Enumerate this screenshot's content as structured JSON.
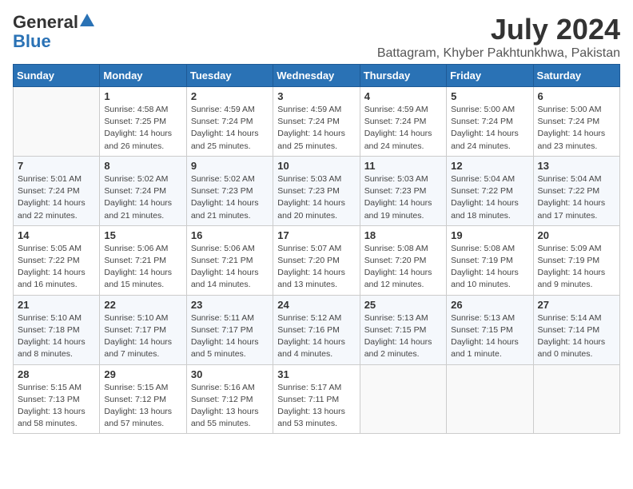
{
  "logo": {
    "general": "General",
    "blue": "Blue"
  },
  "title": "July 2024",
  "subtitle": "Battagram, Khyber Pakhtunkhwa, Pakistan",
  "days_of_week": [
    "Sunday",
    "Monday",
    "Tuesday",
    "Wednesday",
    "Thursday",
    "Friday",
    "Saturday"
  ],
  "weeks": [
    [
      {
        "day": "",
        "info": ""
      },
      {
        "day": "1",
        "info": "Sunrise: 4:58 AM\nSunset: 7:25 PM\nDaylight: 14 hours\nand 26 minutes."
      },
      {
        "day": "2",
        "info": "Sunrise: 4:59 AM\nSunset: 7:24 PM\nDaylight: 14 hours\nand 25 minutes."
      },
      {
        "day": "3",
        "info": "Sunrise: 4:59 AM\nSunset: 7:24 PM\nDaylight: 14 hours\nand 25 minutes."
      },
      {
        "day": "4",
        "info": "Sunrise: 4:59 AM\nSunset: 7:24 PM\nDaylight: 14 hours\nand 24 minutes."
      },
      {
        "day": "5",
        "info": "Sunrise: 5:00 AM\nSunset: 7:24 PM\nDaylight: 14 hours\nand 24 minutes."
      },
      {
        "day": "6",
        "info": "Sunrise: 5:00 AM\nSunset: 7:24 PM\nDaylight: 14 hours\nand 23 minutes."
      }
    ],
    [
      {
        "day": "7",
        "info": "Sunrise: 5:01 AM\nSunset: 7:24 PM\nDaylight: 14 hours\nand 22 minutes."
      },
      {
        "day": "8",
        "info": "Sunrise: 5:02 AM\nSunset: 7:24 PM\nDaylight: 14 hours\nand 21 minutes."
      },
      {
        "day": "9",
        "info": "Sunrise: 5:02 AM\nSunset: 7:23 PM\nDaylight: 14 hours\nand 21 minutes."
      },
      {
        "day": "10",
        "info": "Sunrise: 5:03 AM\nSunset: 7:23 PM\nDaylight: 14 hours\nand 20 minutes."
      },
      {
        "day": "11",
        "info": "Sunrise: 5:03 AM\nSunset: 7:23 PM\nDaylight: 14 hours\nand 19 minutes."
      },
      {
        "day": "12",
        "info": "Sunrise: 5:04 AM\nSunset: 7:22 PM\nDaylight: 14 hours\nand 18 minutes."
      },
      {
        "day": "13",
        "info": "Sunrise: 5:04 AM\nSunset: 7:22 PM\nDaylight: 14 hours\nand 17 minutes."
      }
    ],
    [
      {
        "day": "14",
        "info": "Sunrise: 5:05 AM\nSunset: 7:22 PM\nDaylight: 14 hours\nand 16 minutes."
      },
      {
        "day": "15",
        "info": "Sunrise: 5:06 AM\nSunset: 7:21 PM\nDaylight: 14 hours\nand 15 minutes."
      },
      {
        "day": "16",
        "info": "Sunrise: 5:06 AM\nSunset: 7:21 PM\nDaylight: 14 hours\nand 14 minutes."
      },
      {
        "day": "17",
        "info": "Sunrise: 5:07 AM\nSunset: 7:20 PM\nDaylight: 14 hours\nand 13 minutes."
      },
      {
        "day": "18",
        "info": "Sunrise: 5:08 AM\nSunset: 7:20 PM\nDaylight: 14 hours\nand 12 minutes."
      },
      {
        "day": "19",
        "info": "Sunrise: 5:08 AM\nSunset: 7:19 PM\nDaylight: 14 hours\nand 10 minutes."
      },
      {
        "day": "20",
        "info": "Sunrise: 5:09 AM\nSunset: 7:19 PM\nDaylight: 14 hours\nand 9 minutes."
      }
    ],
    [
      {
        "day": "21",
        "info": "Sunrise: 5:10 AM\nSunset: 7:18 PM\nDaylight: 14 hours\nand 8 minutes."
      },
      {
        "day": "22",
        "info": "Sunrise: 5:10 AM\nSunset: 7:17 PM\nDaylight: 14 hours\nand 7 minutes."
      },
      {
        "day": "23",
        "info": "Sunrise: 5:11 AM\nSunset: 7:17 PM\nDaylight: 14 hours\nand 5 minutes."
      },
      {
        "day": "24",
        "info": "Sunrise: 5:12 AM\nSunset: 7:16 PM\nDaylight: 14 hours\nand 4 minutes."
      },
      {
        "day": "25",
        "info": "Sunrise: 5:13 AM\nSunset: 7:15 PM\nDaylight: 14 hours\nand 2 minutes."
      },
      {
        "day": "26",
        "info": "Sunrise: 5:13 AM\nSunset: 7:15 PM\nDaylight: 14 hours\nand 1 minute."
      },
      {
        "day": "27",
        "info": "Sunrise: 5:14 AM\nSunset: 7:14 PM\nDaylight: 14 hours\nand 0 minutes."
      }
    ],
    [
      {
        "day": "28",
        "info": "Sunrise: 5:15 AM\nSunset: 7:13 PM\nDaylight: 13 hours\nand 58 minutes."
      },
      {
        "day": "29",
        "info": "Sunrise: 5:15 AM\nSunset: 7:12 PM\nDaylight: 13 hours\nand 57 minutes."
      },
      {
        "day": "30",
        "info": "Sunrise: 5:16 AM\nSunset: 7:12 PM\nDaylight: 13 hours\nand 55 minutes."
      },
      {
        "day": "31",
        "info": "Sunrise: 5:17 AM\nSunset: 7:11 PM\nDaylight: 13 hours\nand 53 minutes."
      },
      {
        "day": "",
        "info": ""
      },
      {
        "day": "",
        "info": ""
      },
      {
        "day": "",
        "info": ""
      }
    ]
  ]
}
